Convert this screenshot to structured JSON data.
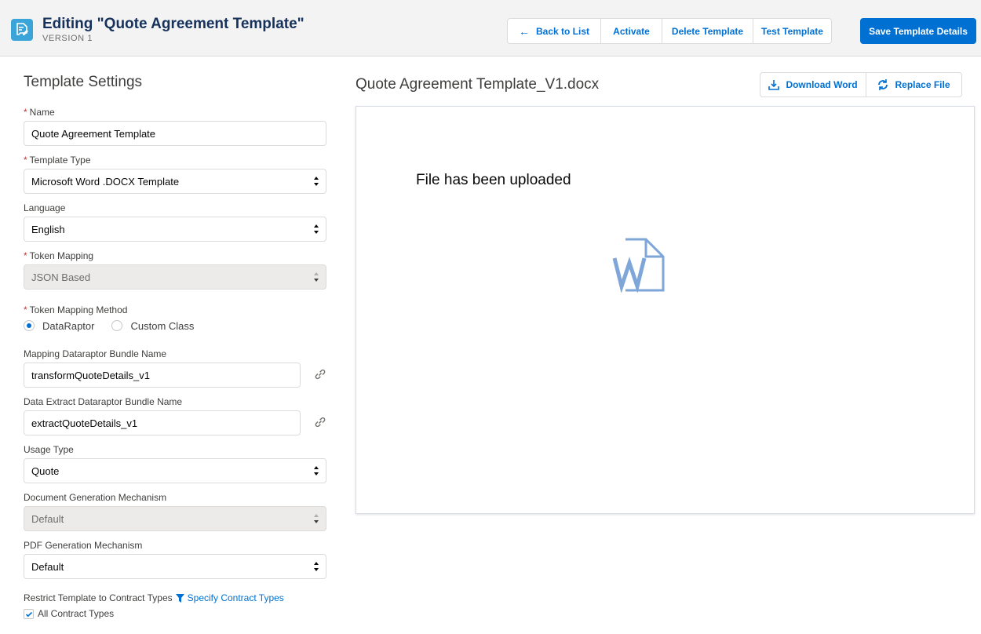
{
  "header": {
    "title": "Editing \"Quote Agreement Template\"",
    "subtitle": "VERSION 1",
    "buttons": {
      "back": "Back to List",
      "activate": "Activate",
      "delete": "Delete Template",
      "test": "Test Template",
      "save": "Save Template Details"
    }
  },
  "settings": {
    "title": "Template Settings",
    "name": {
      "label": "Name",
      "value": "Quote Agreement Template",
      "required": true
    },
    "template_type": {
      "label": "Template Type",
      "value": "Microsoft Word .DOCX Template",
      "required": true
    },
    "language": {
      "label": "Language",
      "value": "English"
    },
    "token_mapping": {
      "label": "Token Mapping",
      "value": "JSON Based",
      "required": true,
      "disabled": true
    },
    "token_mapping_method": {
      "label": "Token Mapping Method",
      "required": true,
      "options": [
        "DataRaptor",
        "Custom Class"
      ],
      "selected": "DataRaptor"
    },
    "mapping_bundle": {
      "label": "Mapping Dataraptor Bundle Name",
      "value": "transformQuoteDetails_v1"
    },
    "extract_bundle": {
      "label": "Data Extract Dataraptor Bundle Name",
      "value": "extractQuoteDetails_v1"
    },
    "usage_type": {
      "label": "Usage Type",
      "value": "Quote"
    },
    "doc_gen_mechanism": {
      "label": "Document Generation Mechanism",
      "value": "Default",
      "disabled": true
    },
    "pdf_gen_mechanism": {
      "label": "PDF Generation Mechanism",
      "value": "Default"
    },
    "restrict": {
      "label": "Restrict Template to Contract Types",
      "link": "Specify Contract Types",
      "checkbox_label": "All Contract Types",
      "checked": true
    }
  },
  "file": {
    "name": "Quote Agreement Template_V1.docx",
    "download": "Download Word",
    "replace": "Replace File",
    "status": "File has been uploaded",
    "icon": "word-document-icon"
  },
  "colors": {
    "brand": "#0070d2",
    "header_bg": "#f3f3f3",
    "app_icon": "#3ba4d8",
    "required": "#c23934",
    "word_icon": "#7ea6d9"
  }
}
